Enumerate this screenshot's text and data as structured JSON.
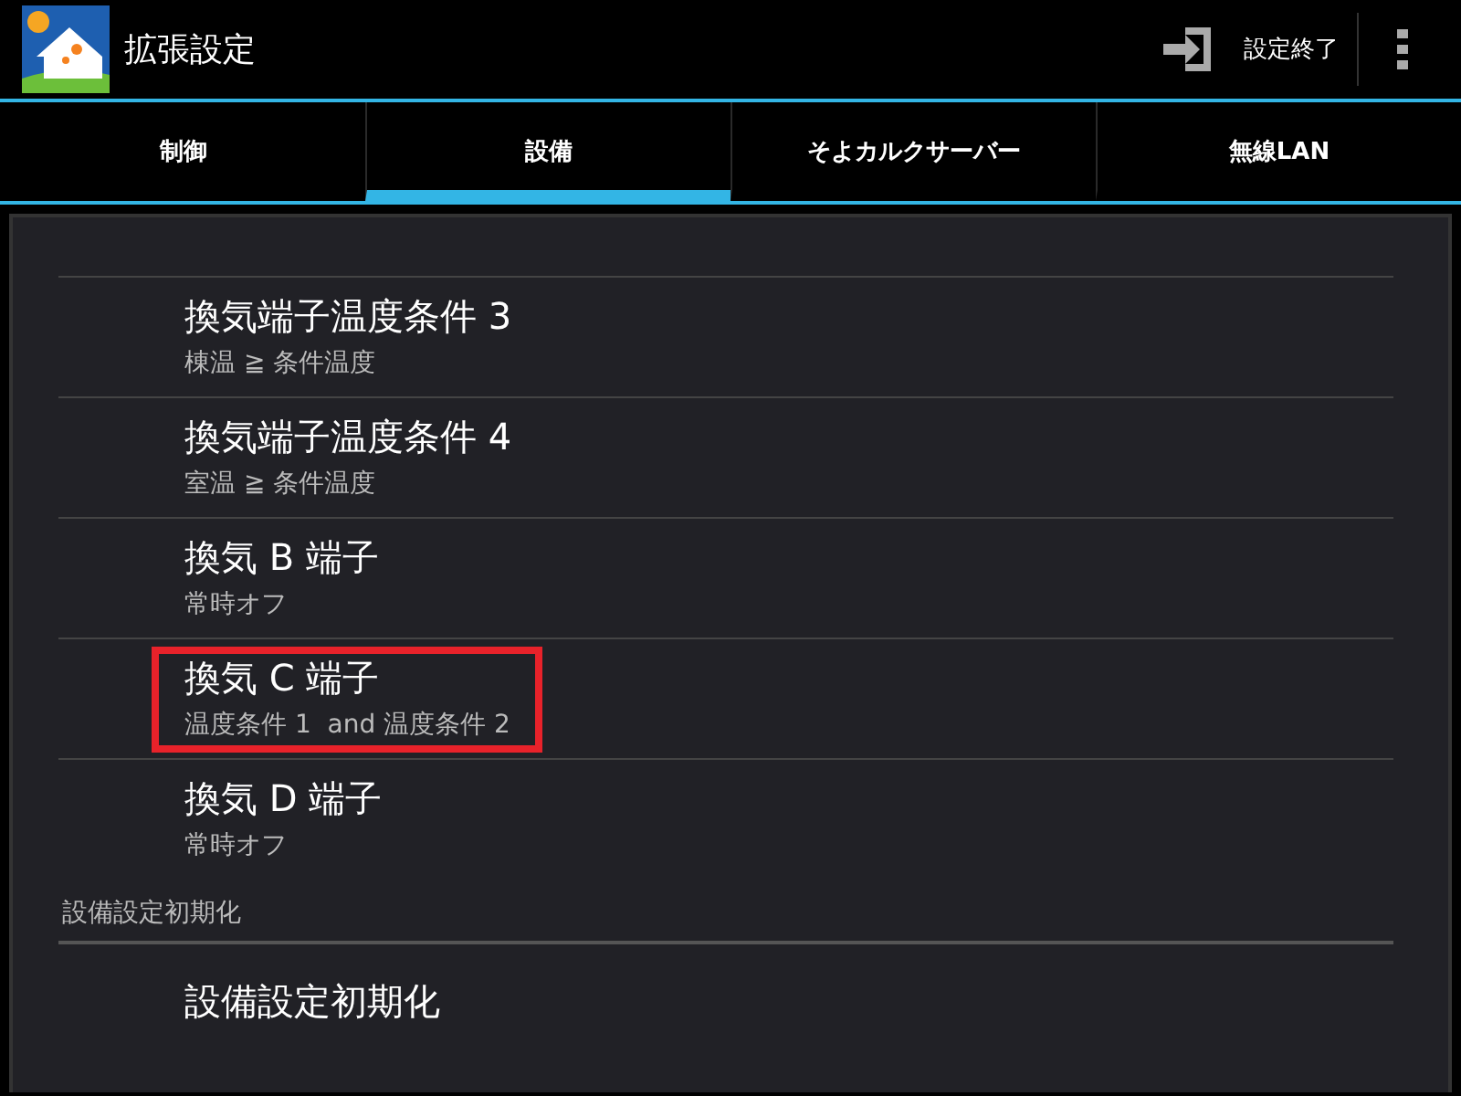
{
  "action_bar": {
    "title": "拡張設定",
    "action_label": "設定終了"
  },
  "tabs": [
    {
      "label": "制御",
      "selected": false
    },
    {
      "label": "設備",
      "selected": true
    },
    {
      "label": "そよカルクサーバー",
      "selected": false
    },
    {
      "label": "無線LAN",
      "selected": false
    }
  ],
  "preferences": [
    {
      "kind": "item",
      "title": "換気端子温度条件 3",
      "summary": "棟温 ≧ 条件温度",
      "highlighted": false
    },
    {
      "kind": "item",
      "title": "換気端子温度条件 4",
      "summary": "室温 ≧ 条件温度",
      "highlighted": false
    },
    {
      "kind": "item",
      "title": "換気 B 端子",
      "summary": "常時オフ",
      "highlighted": false
    },
    {
      "kind": "item",
      "title": "換気 C 端子",
      "summary": "温度条件 1  and 温度条件 2",
      "highlighted": true
    },
    {
      "kind": "item",
      "title": "換気 D 端子",
      "summary": "常時オフ",
      "highlighted": false
    },
    {
      "kind": "category",
      "title": "設備設定初期化"
    },
    {
      "kind": "item",
      "title": "設備設定初期化",
      "highlighted": false
    }
  ]
}
